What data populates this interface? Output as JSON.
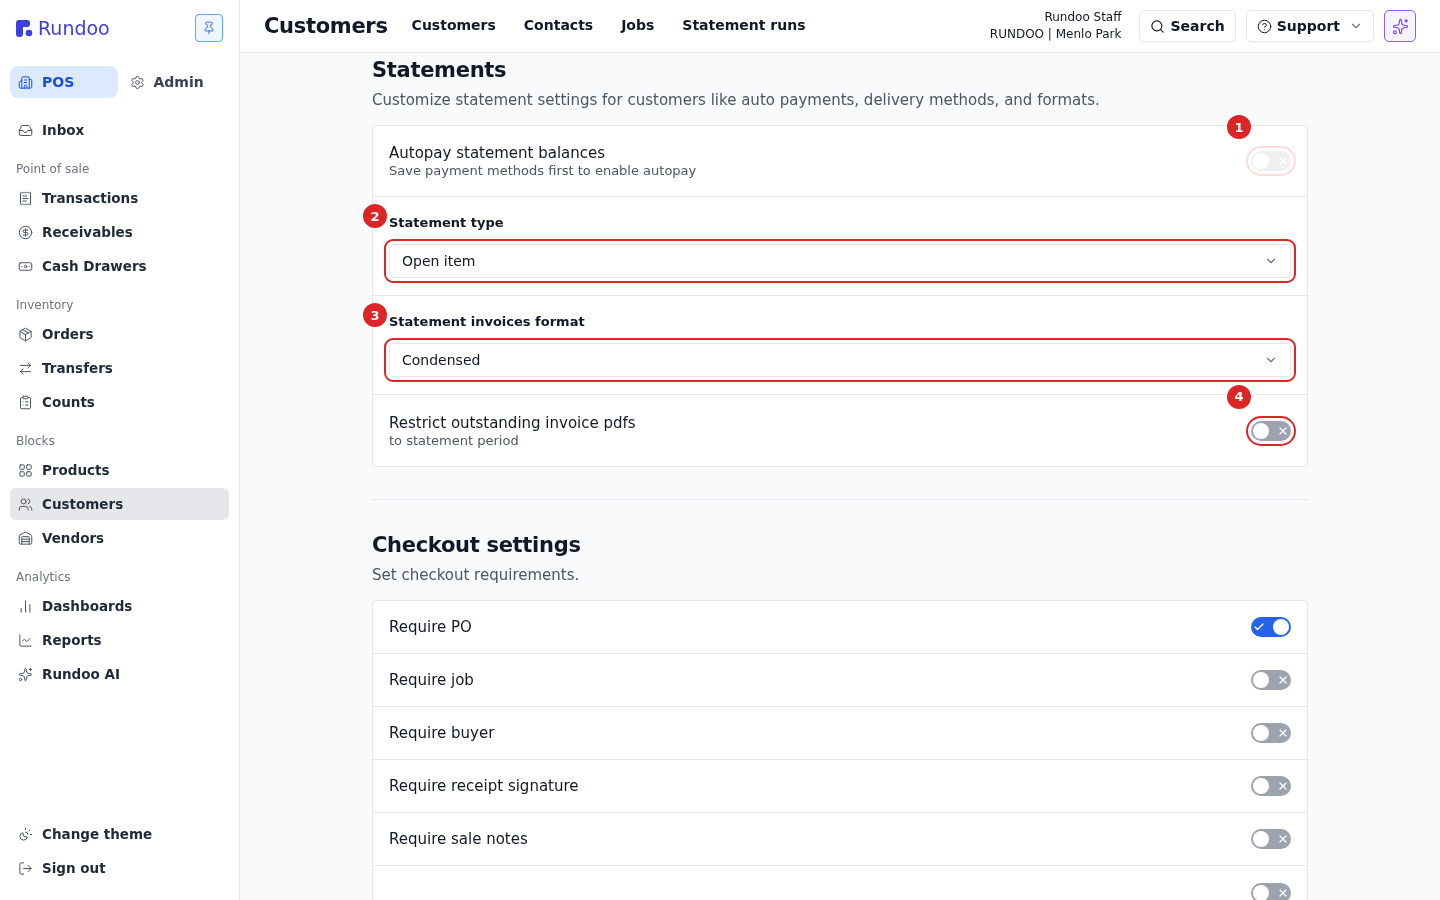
{
  "sidebar": {
    "logo": "Rundoo",
    "modes": [
      {
        "label": "POS",
        "kind": "building",
        "selected": true
      },
      {
        "label": "Admin",
        "kind": "gear",
        "selected": false
      }
    ],
    "sections": [
      {
        "items": [
          {
            "label": "Inbox",
            "kind": "inbox",
            "selected": false
          }
        ]
      },
      {
        "title": "Point of sale",
        "items": [
          {
            "label": "Transactions",
            "kind": "receipt",
            "selected": false
          },
          {
            "label": "Receivables",
            "kind": "dollar",
            "selected": false
          },
          {
            "label": "Cash Drawers",
            "kind": "cash",
            "selected": false
          }
        ]
      },
      {
        "title": "Inventory",
        "items": [
          {
            "label": "Orders",
            "kind": "package",
            "selected": false
          },
          {
            "label": "Transfers",
            "kind": "arrows",
            "selected": false
          },
          {
            "label": "Counts",
            "kind": "clipboard",
            "selected": false
          }
        ]
      },
      {
        "title": "Blocks",
        "items": [
          {
            "label": "Products",
            "kind": "grid",
            "selected": false
          },
          {
            "label": "Customers",
            "kind": "users",
            "selected": true
          },
          {
            "label": "Vendors",
            "kind": "warehouse",
            "selected": false
          }
        ]
      },
      {
        "title": "Analytics",
        "items": [
          {
            "label": "Dashboards",
            "kind": "bars",
            "selected": false
          },
          {
            "label": "Reports",
            "kind": "line",
            "selected": false
          },
          {
            "label": "Rundoo AI",
            "kind": "sparkles",
            "selected": false
          }
        ]
      }
    ],
    "footer": [
      {
        "label": "Change theme",
        "kind": "theme"
      },
      {
        "label": "Sign out",
        "kind": "logout"
      }
    ]
  },
  "header": {
    "title": "Customers",
    "tabs": [
      {
        "label": "Customers",
        "selected": false
      },
      {
        "label": "Contacts",
        "selected": false
      },
      {
        "label": "Jobs",
        "selected": false
      },
      {
        "label": "Statement runs",
        "selected": false
      }
    ],
    "user": {
      "name": "Rundoo Staff",
      "store": "RUNDOO | Menlo Park"
    },
    "search": "Search",
    "support": "Support"
  },
  "statements": {
    "title": "Statements",
    "description": "Customize statement settings for customers like auto payments, delivery methods, and formats.",
    "rows": [
      {
        "kind": "toggle",
        "label": "Autopay statement balances",
        "sublabel": "Save payment methods first to enable autopay",
        "on": false,
        "disabled": true,
        "annotation": "1"
      },
      {
        "kind": "select",
        "label": "Statement type",
        "value": "Open item",
        "annotation": "2"
      },
      {
        "kind": "select",
        "label": "Statement invoices format",
        "value": "Condensed",
        "annotation": "3"
      },
      {
        "kind": "toggle",
        "label": "Restrict outstanding invoice pdfs",
        "sublabel": "to statement period",
        "on": false,
        "disabled": false,
        "annotation": "4"
      }
    ]
  },
  "checkout": {
    "title": "Checkout settings",
    "description": "Set checkout requirements.",
    "rows": [
      {
        "label": "Require PO",
        "on": true
      },
      {
        "label": "Require job",
        "on": false
      },
      {
        "label": "Require buyer",
        "on": false
      },
      {
        "label": "Require receipt signature",
        "on": false
      },
      {
        "label": "Require sale notes",
        "on": false
      },
      {
        "on": false
      }
    ]
  }
}
